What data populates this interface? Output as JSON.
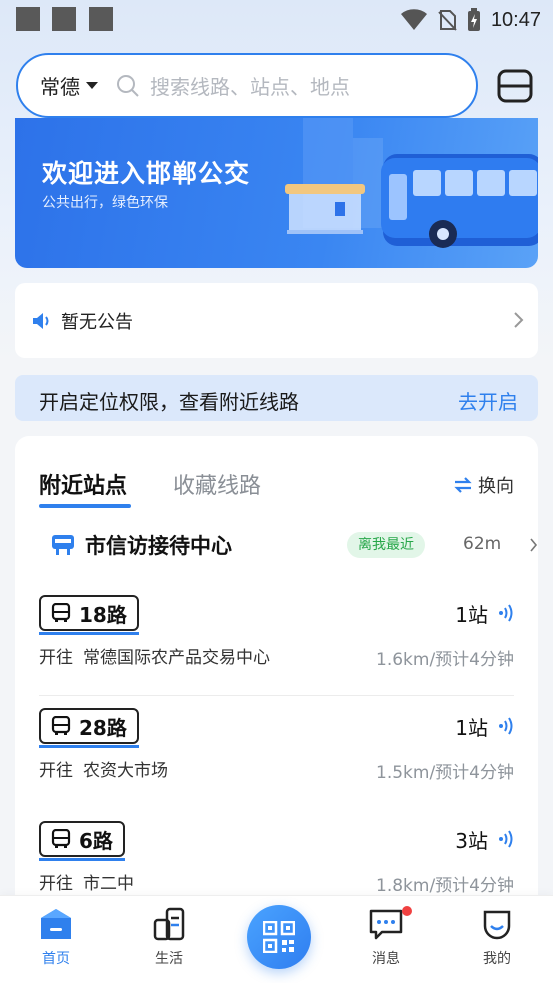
{
  "status_bar": {
    "time": "10:47"
  },
  "search": {
    "city": "常德",
    "placeholder": "搜索线路、站点、地点"
  },
  "banner": {
    "title": "欢迎进入邯郸公交",
    "subtitle": "公共出行，绿色环保"
  },
  "notice": {
    "text": "暂无公告"
  },
  "location": {
    "text": "开启定位权限，查看附近线路",
    "action": "去开启"
  },
  "tabs": {
    "active": "附近站点",
    "inactive": "收藏线路",
    "switch_label": "换向"
  },
  "nearest_stop": {
    "name": "市信访接待中心",
    "badge": "离我最近",
    "distance": "62m"
  },
  "routes": [
    {
      "name": "18路",
      "stations": "1站",
      "dest_prefix": "开往",
      "destination": "常德国际农产品交易中心",
      "eta": "1.6km/预计4分钟"
    },
    {
      "name": "28路",
      "stations": "1站",
      "dest_prefix": "开往",
      "destination": "农资大市场",
      "eta": "1.5km/预计4分钟"
    },
    {
      "name": "6路",
      "stations": "3站",
      "dest_prefix": "开往",
      "destination": "市二中",
      "eta": "1.8km/预计4分钟"
    }
  ],
  "nav": {
    "home": "首页",
    "life": "生活",
    "messages": "消息",
    "mine": "我的"
  },
  "colors": {
    "accent": "#2f80ed",
    "badge_green": "#28a74a",
    "banner": "#3a86f2"
  }
}
